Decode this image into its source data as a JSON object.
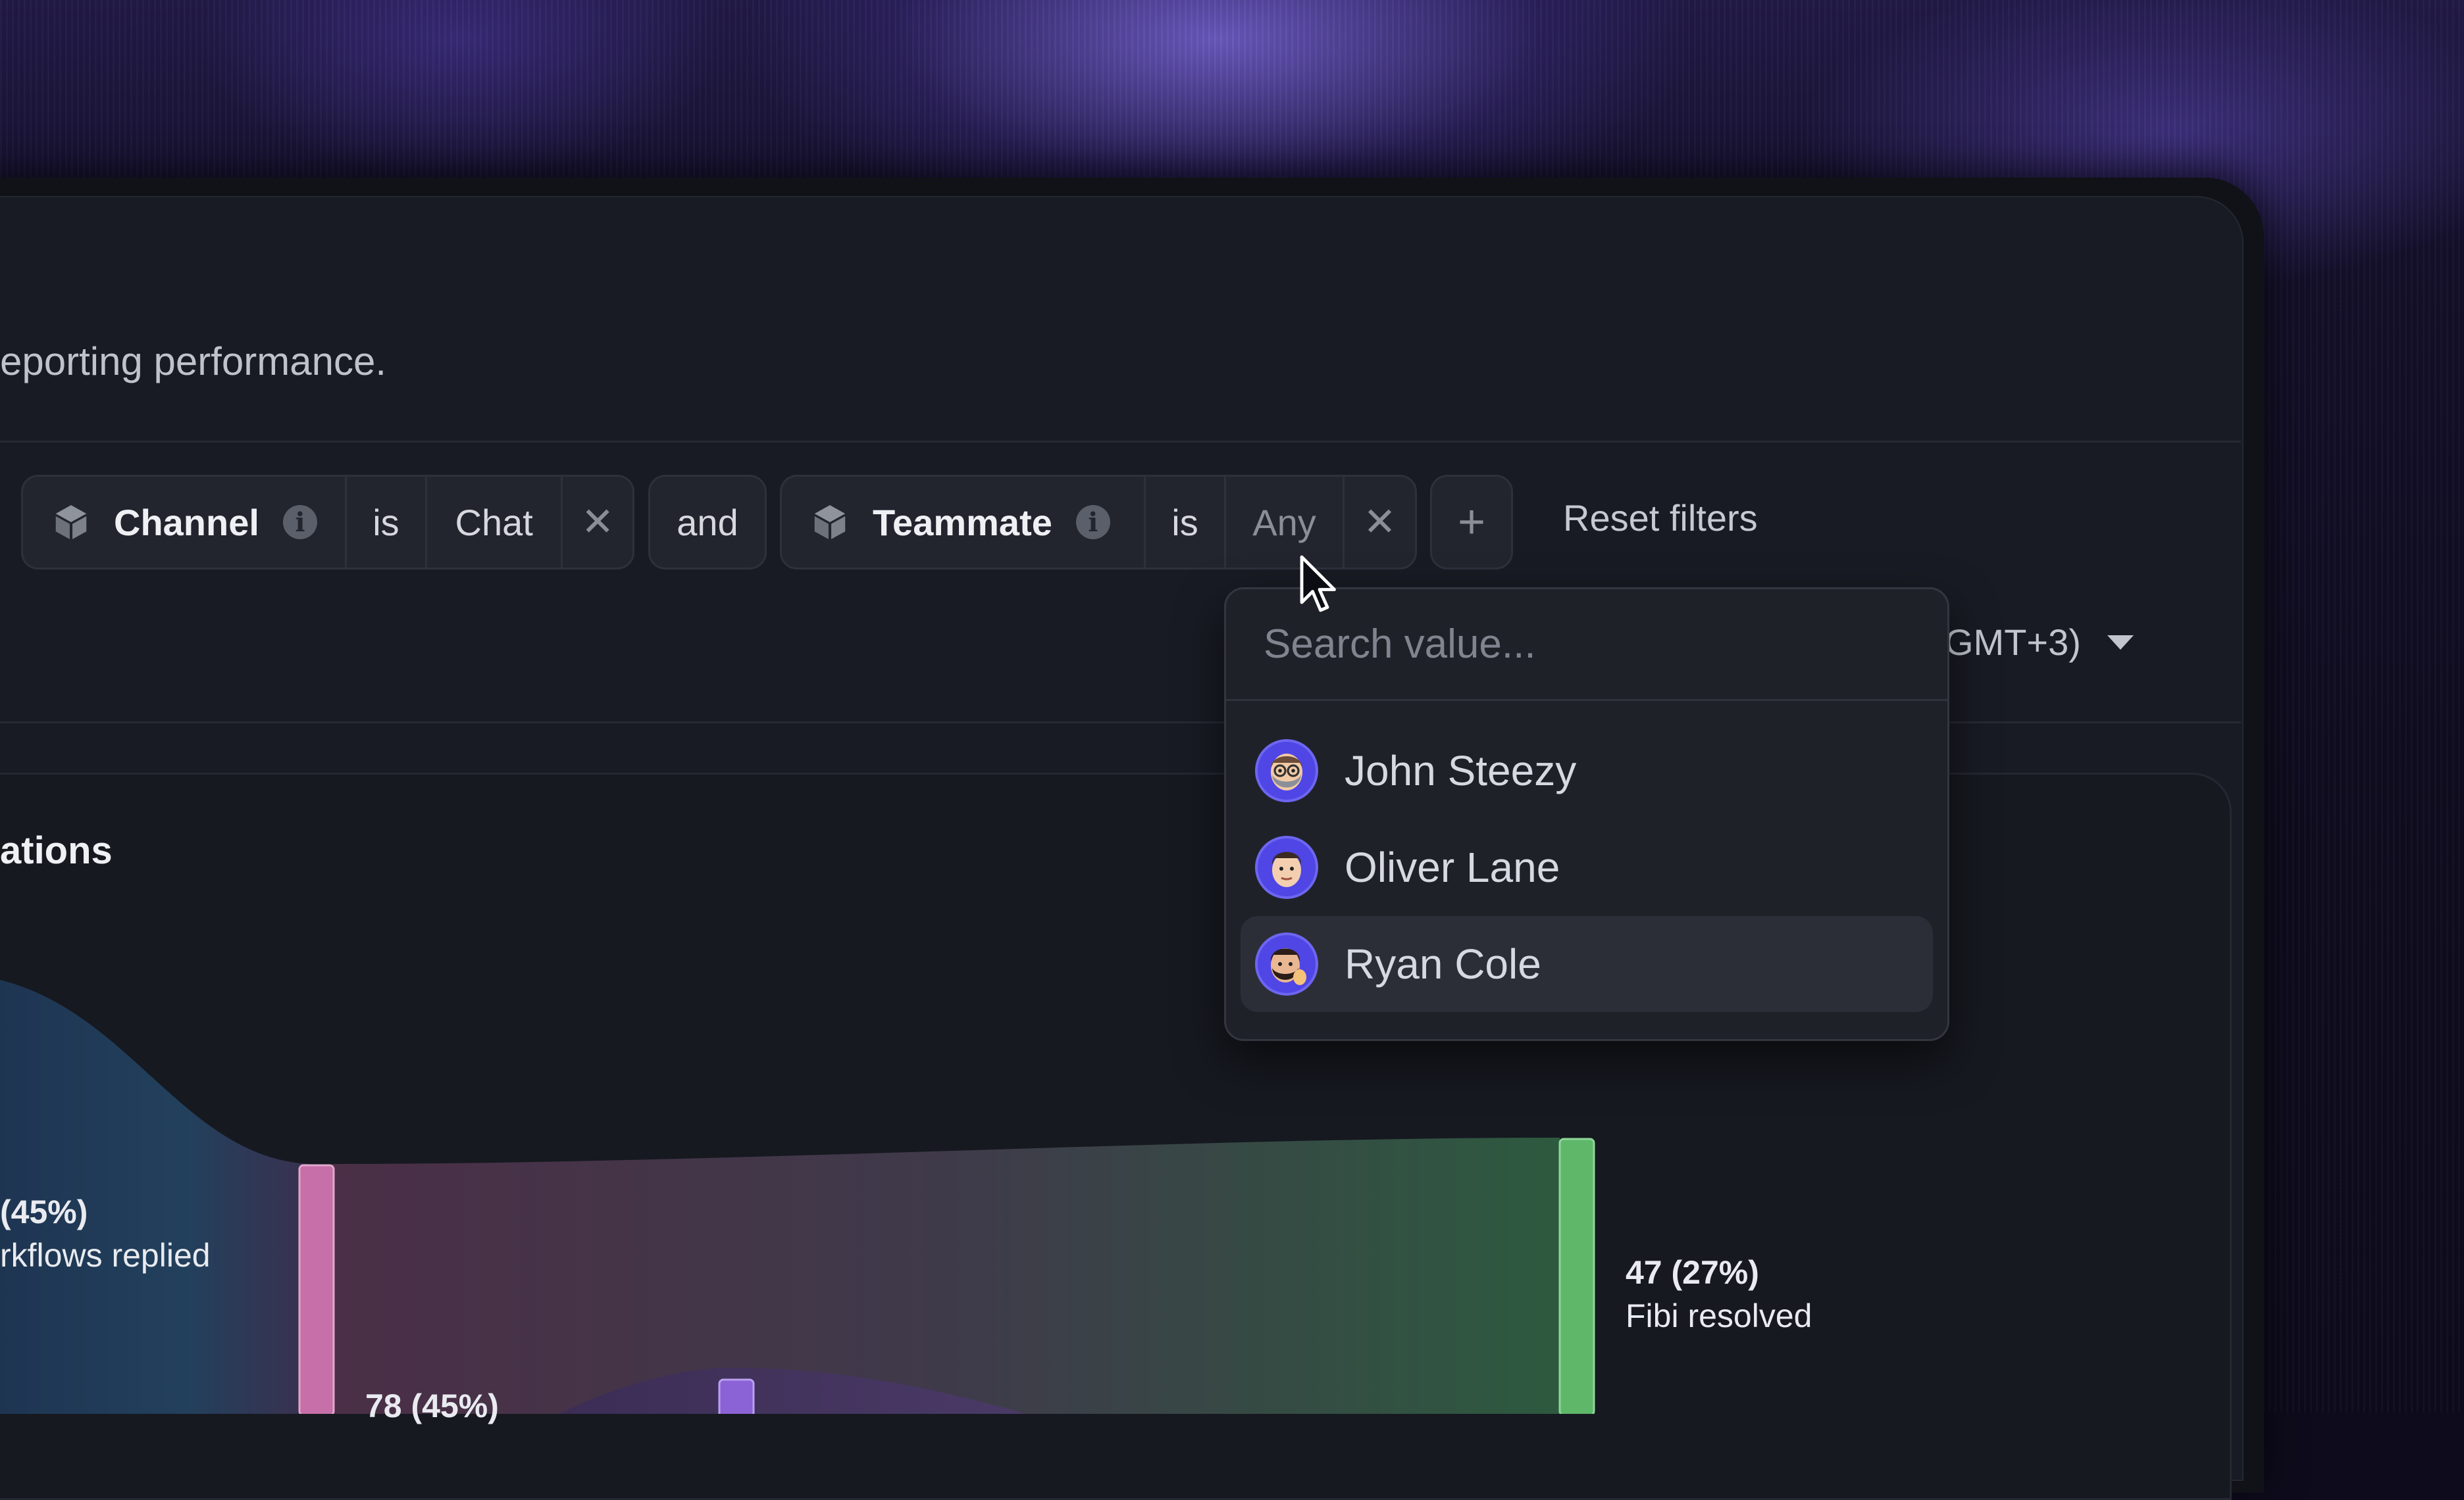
{
  "header": {
    "subtitle": "eporting performance."
  },
  "filters": {
    "filter1": {
      "field": "Channel",
      "operator": "is",
      "value": "Chat"
    },
    "conjunction": "and",
    "filter2": {
      "field": "Teammate",
      "operator": "is",
      "value": "Any"
    },
    "add_icon": "+",
    "remove_icon": "✕",
    "info_icon": "i",
    "reset_label": "Reset filters"
  },
  "timezone": {
    "label": "GMT+3)"
  },
  "dropdown": {
    "search_placeholder": "Search value...",
    "options": [
      {
        "name": "John Steezy",
        "highlighted": false
      },
      {
        "name": "Oliver Lane",
        "highlighted": false
      },
      {
        "name": "Ryan Cole",
        "highlighted": true
      }
    ]
  },
  "card": {
    "title": "ations",
    "flows": [
      {
        "value": "(45%)",
        "label": "rkflows replied"
      },
      {
        "value": "47 (27%)",
        "label": "Fibi resolved"
      },
      {
        "value": "78 (45%)",
        "label": ""
      }
    ]
  },
  "colors": {
    "accent_pink": "#c76fa8",
    "accent_purple": "#8b63d6",
    "accent_green": "#5fb76a",
    "avatar_bg": "#4f46e5"
  }
}
